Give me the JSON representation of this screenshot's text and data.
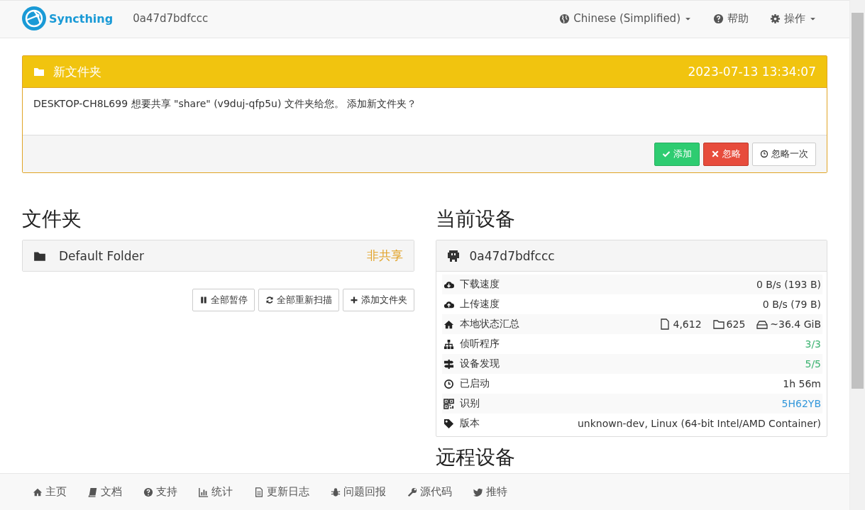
{
  "navbar": {
    "brand": "Syncthing",
    "device_name": "0a47d7bdfccc",
    "menus": [
      {
        "label": "Chinese (Simplified)",
        "dropdown": true
      },
      {
        "label": "帮助",
        "dropdown": false
      },
      {
        "label": "操作",
        "dropdown": true
      }
    ]
  },
  "notice": {
    "title": "新文件夹",
    "time": "2023-07-13 13:34:07",
    "message": "DESKTOP-CH8L699 想要共享 \"share\" (v9duj-qfp5u) 文件夹给您。 添加新文件夹？",
    "buttons": [
      {
        "label": "添加",
        "kind": "success"
      },
      {
        "label": "忽略",
        "kind": "danger"
      },
      {
        "label": "忽略一次",
        "kind": "default"
      }
    ]
  },
  "folders": {
    "heading": "文件夹",
    "items": [
      {
        "name": "Default Folder",
        "status": "非共享"
      }
    ],
    "buttons": [
      {
        "label": "全部暂停"
      },
      {
        "label": "全部重新扫描"
      },
      {
        "label": "添加文件夹"
      }
    ]
  },
  "this_device": {
    "heading": "当前设备",
    "name": "0a47d7bdfccc",
    "rows": [
      {
        "kind": "text",
        "label": "下载速度",
        "value": "0 B/s (193 B)"
      },
      {
        "kind": "text",
        "label": "上传速度",
        "value": "0 B/s (79 B)"
      },
      {
        "kind": "summary",
        "label": "本地状态汇总",
        "files": "4,612",
        "dirs": "625",
        "size": "~36.4 GiB"
      },
      {
        "kind": "text",
        "label": "侦听程序",
        "value": "3/3",
        "color": "#3cb371"
      },
      {
        "kind": "text",
        "label": "设备发现",
        "value": "5/5",
        "color": "#3cb371"
      },
      {
        "kind": "text",
        "label": "已启动",
        "value": "1h 56m"
      },
      {
        "kind": "text",
        "label": "识别",
        "value": "5H62YB",
        "color": "#3498db"
      },
      {
        "kind": "text",
        "label": "版本",
        "value": "unknown-dev, Linux (64-bit Intel/AMD Container)"
      }
    ]
  },
  "remote_devices": {
    "heading": "远程设备"
  },
  "footer": {
    "links": [
      {
        "label": "主页"
      },
      {
        "label": "文档"
      },
      {
        "label": "支持"
      },
      {
        "label": "统计"
      },
      {
        "label": "更新日志"
      },
      {
        "label": "问题回报"
      },
      {
        "label": "源代码"
      },
      {
        "label": "推特"
      }
    ]
  }
}
